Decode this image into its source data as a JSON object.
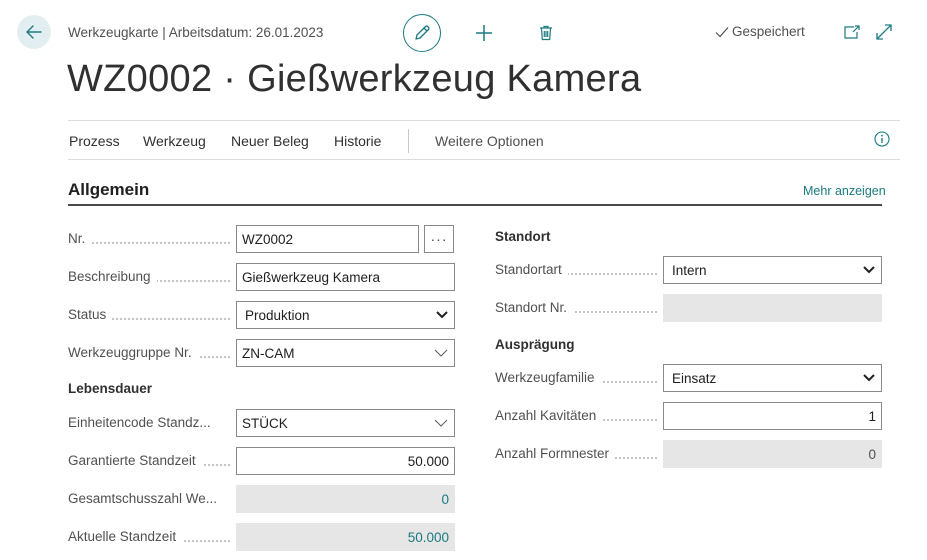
{
  "header": {
    "breadcrumb": "Werkzeugkarte | Arbeitsdatum: 26.01.2023",
    "saved_label": "Gespeichert",
    "title": "WZ0002 · Gießwerkzeug Kamera"
  },
  "actions": {
    "items": [
      "Prozess",
      "Werkzeug",
      "Neuer Beleg",
      "Historie"
    ],
    "more_label": "Weitere Optionen"
  },
  "section": {
    "title": "Allgemein",
    "show_more": "Mehr anzeigen"
  },
  "left": {
    "nr": {
      "label": "Nr.",
      "value": "WZ0002",
      "lookup": "···"
    },
    "beschreibung": {
      "label": "Beschreibung",
      "value": "Gießwerkzeug Kamera"
    },
    "status": {
      "label": "Status",
      "value": "Produktion"
    },
    "werkzeuggruppe": {
      "label": "Werkzeuggruppe Nr.",
      "value": "ZN-CAM"
    },
    "lebensdauer_title": "Lebensdauer",
    "einheitencode": {
      "label": "Einheitencode Standz...",
      "value": "STÜCK"
    },
    "garantierte": {
      "label": "Garantierte Standzeit",
      "value": "50.000"
    },
    "gesamtschuss": {
      "label": "Gesamtschusszahl We...",
      "value": "0"
    },
    "aktuelle": {
      "label": "Aktuelle Standzeit",
      "value": "50.000"
    }
  },
  "right": {
    "standort_title": "Standort",
    "standortart": {
      "label": "Standortart",
      "value": "Intern"
    },
    "standort_nr": {
      "label": "Standort Nr.",
      "value": ""
    },
    "auspraegung_title": "Ausprägung",
    "werkzeugfamilie": {
      "label": "Werkzeugfamilie",
      "value": "Einsatz"
    },
    "kavitaeten": {
      "label": "Anzahl Kavitäten",
      "value": "1"
    },
    "formnester": {
      "label": "Anzahl Formnester",
      "value": "0"
    }
  },
  "colors": {
    "accent": "#1a7a82",
    "back_bg": "#e3eef2",
    "readonly_bg": "#e6e6e6"
  },
  "icons": [
    "back-arrow-icon",
    "pencil-icon",
    "plus-icon",
    "trash-icon",
    "checkmark-icon",
    "popout-icon",
    "expand-icon",
    "info-icon",
    "chevron-down-icon"
  ]
}
